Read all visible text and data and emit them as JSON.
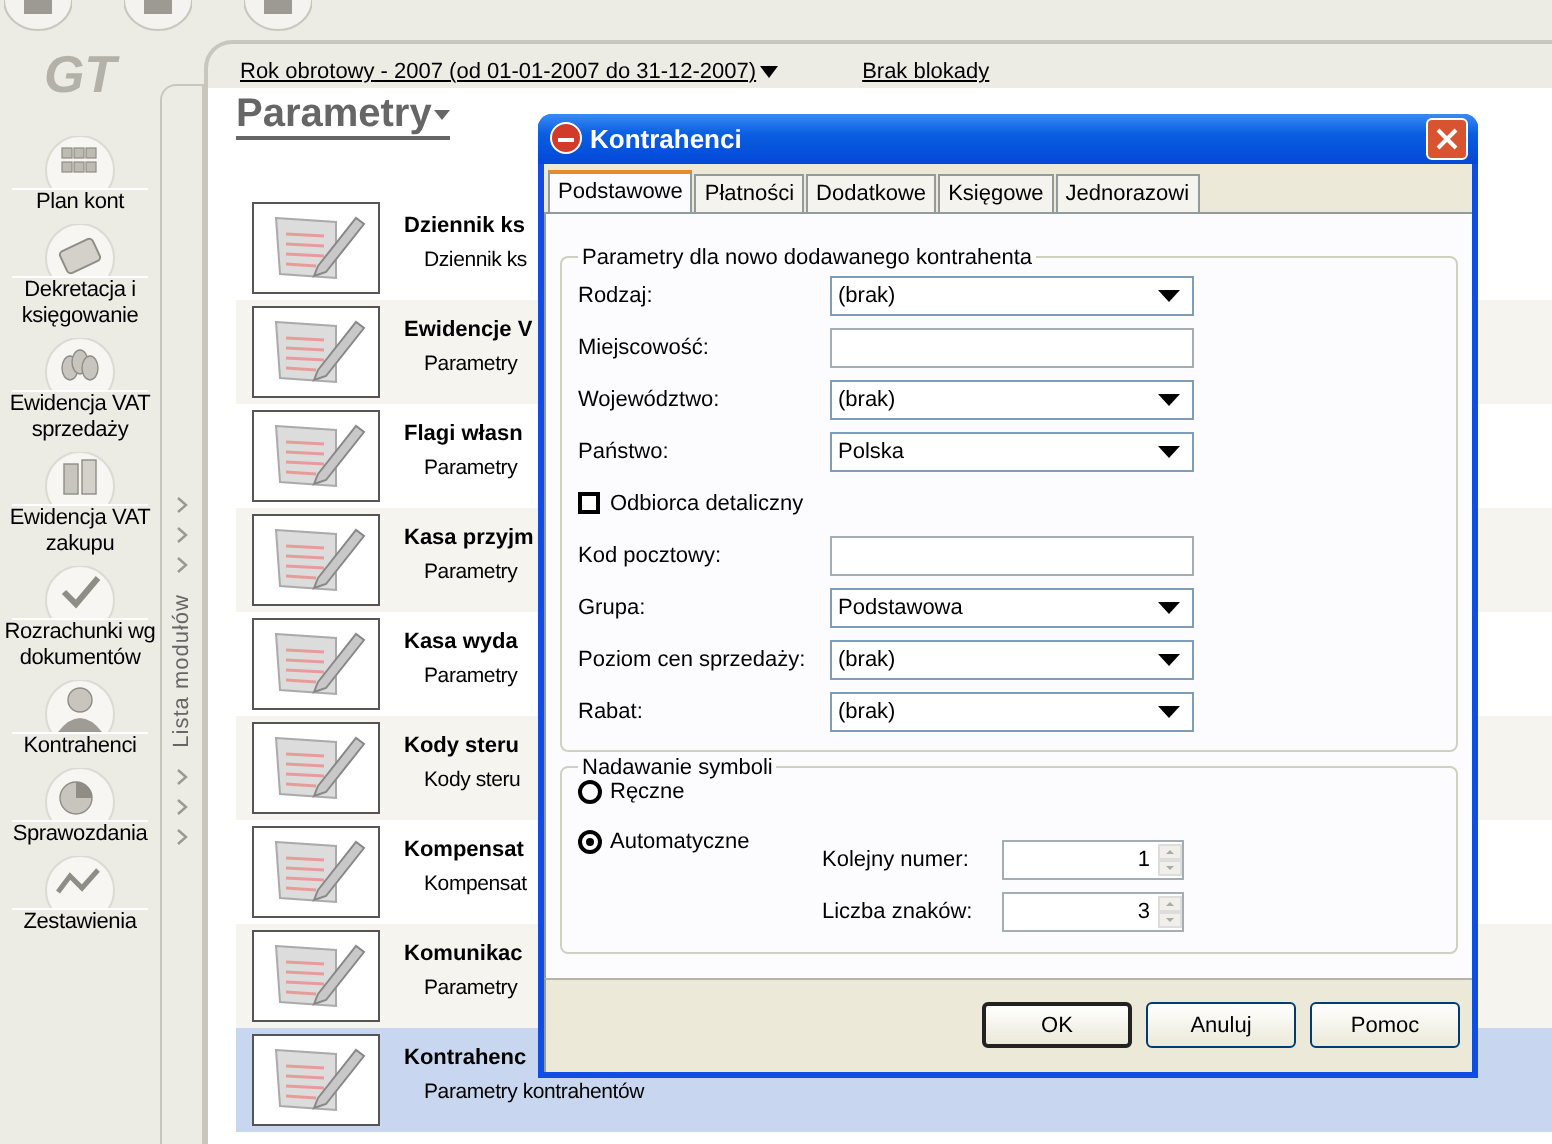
{
  "header": {
    "fiscal_year": "Rok obrotowy - 2007  (od 01-01-2007 do 31-12-2007)",
    "lock_status": "Brak blokady"
  },
  "sidebar": {
    "logo": "GT",
    "items": [
      {
        "label": "Plan kont"
      },
      {
        "label": "Dekretacja i księgowanie"
      },
      {
        "label": "Ewidencja VAT sprzedaży"
      },
      {
        "label": "Ewidencja VAT zakupu"
      },
      {
        "label": "Rozrachunki wg dokumentów"
      },
      {
        "label": "Kontrahenci"
      },
      {
        "label": "Sprawozdania"
      },
      {
        "label": "Zestawienia"
      }
    ]
  },
  "module_strip": {
    "label": "Lista modułów"
  },
  "page_title": "Parametry",
  "list": [
    {
      "title": "Dziennik ks",
      "subtitle": "Dziennik ks",
      "selected": false
    },
    {
      "title": "Ewidencje V",
      "subtitle": "Parametry",
      "selected": false
    },
    {
      "title": "Flagi własn",
      "subtitle": "Parametry",
      "selected": false
    },
    {
      "title": "Kasa przyjm",
      "subtitle": "Parametry",
      "selected": false
    },
    {
      "title": "Kasa wyda",
      "subtitle": "Parametry",
      "selected": false
    },
    {
      "title": "Kody steru",
      "subtitle": "Kody steru",
      "selected": false
    },
    {
      "title": "Kompensat",
      "subtitle": "Kompensat",
      "selected": false
    },
    {
      "title": "Komunikac",
      "subtitle": "Parametry",
      "selected": false
    },
    {
      "title": "Kontrahenc",
      "subtitle": "Parametry kontrahentów",
      "selected": true
    }
  ],
  "dialog": {
    "title": "Kontrahenci",
    "tabs": [
      {
        "label": "Podstawowe",
        "selected": true
      },
      {
        "label": "Płatności",
        "selected": false
      },
      {
        "label": "Dodatkowe",
        "selected": false
      },
      {
        "label": "Księgowe",
        "selected": false
      },
      {
        "label": "Jednorazowi",
        "selected": false
      }
    ],
    "group1": {
      "title": "Parametry dla nowo dodawanego kontrahenta",
      "rows": [
        {
          "kind": "select",
          "label": "Rodzaj:",
          "value": "(brak)"
        },
        {
          "kind": "text",
          "label": "Miejscowość:"
        },
        {
          "kind": "select",
          "label": "Województwo:",
          "value": "(brak)"
        },
        {
          "kind": "select",
          "label": "Państwo:",
          "value": "Polska"
        },
        {
          "kind": "checkbox",
          "label": "Odbiorca detaliczny",
          "checked": false
        },
        {
          "kind": "text",
          "label": "Kod pocztowy:"
        },
        {
          "kind": "select",
          "label": "Grupa:",
          "value": "Podstawowa"
        },
        {
          "kind": "select",
          "label": "Poziom cen sprzedaży:",
          "value": "(brak)"
        },
        {
          "kind": "select",
          "label": "Rabat:",
          "value": "(brak)"
        }
      ]
    },
    "group2": {
      "title": "Nadawanie symboli",
      "radios": [
        {
          "label": "Ręczne",
          "selected": false
        },
        {
          "label": "Automatyczne",
          "selected": true
        }
      ],
      "spinners": [
        {
          "label": "Kolejny numer:",
          "value": "1"
        },
        {
          "label": "Liczba znaków:",
          "value": "3"
        }
      ]
    },
    "buttons": [
      {
        "label": "OK",
        "default": true
      },
      {
        "label": "Anuluj",
        "default": false
      },
      {
        "label": "Pomoc",
        "default": false
      }
    ]
  }
}
